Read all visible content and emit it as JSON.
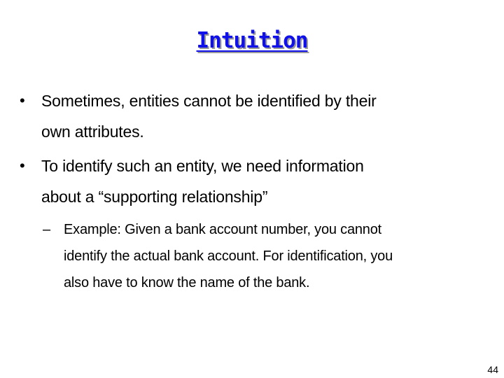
{
  "slide": {
    "title": "Intuition",
    "bullets": [
      {
        "marker": "•",
        "lines": [
          "Sometimes, entities cannot be identified by their",
          "own attributes."
        ]
      },
      {
        "marker": "•",
        "lines": [
          "To identify such an entity, we need information",
          "about a “supporting relationship”"
        ],
        "sub_bullets": [
          {
            "marker": "–",
            "lines": [
              "Example: Given a bank account number, you cannot",
              "identify the actual bank account. For identification, you",
              "also have to know the name of the bank."
            ]
          }
        ]
      }
    ],
    "page_number": "44"
  },
  "colors": {
    "title": "#1010e8",
    "title_shadow": "#9a9a9a",
    "text": "#000000",
    "background": "#ffffff"
  }
}
